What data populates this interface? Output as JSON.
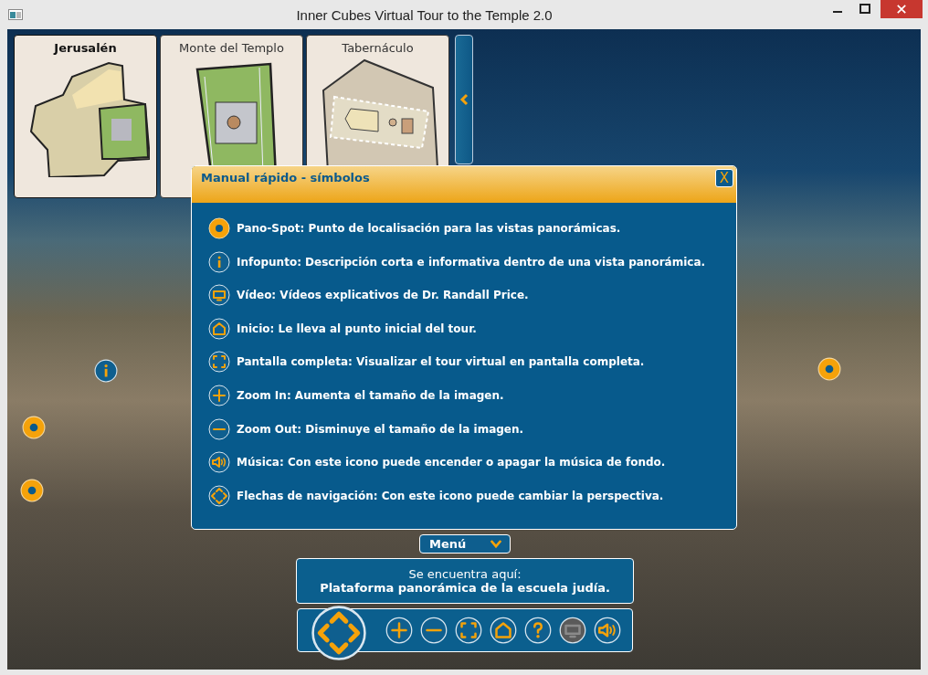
{
  "window": {
    "title": "Inner Cubes Virtual Tour to the Temple 2.0"
  },
  "maps": [
    {
      "label": "Jerusalén",
      "selected": true,
      "kind": "city"
    },
    {
      "label": "Monte del Templo",
      "selected": false,
      "kind": "mount"
    },
    {
      "label": "Tabernáculo",
      "selected": false,
      "kind": "tabernacle"
    }
  ],
  "hotspots": [
    {
      "kind": "info"
    },
    {
      "kind": "pano"
    },
    {
      "kind": "pano"
    },
    {
      "kind": "pano"
    }
  ],
  "dialog": {
    "title": "Manual rápido - símbolos",
    "close": "X",
    "items": [
      {
        "kind": "pano",
        "text": "Pano-Spot: Punto de localisación para las vistas panorámicas."
      },
      {
        "kind": "info",
        "text": "Infopunto: Descripción corta e informativa dentro de una vista panorámica."
      },
      {
        "kind": "video",
        "text": "Vídeo: Vídeos explicativos de Dr. Randall Price."
      },
      {
        "kind": "home",
        "text": "Inicio: Le lleva al punto inicial del tour."
      },
      {
        "kind": "fullscreen",
        "text": "Pantalla completa: Visualizar el tour virtual en pantalla completa."
      },
      {
        "kind": "plus",
        "text": "Zoom In: Aumenta el tamaño de la imagen."
      },
      {
        "kind": "minus",
        "text": "Zoom Out: Disminuye el tamaño de la imagen."
      },
      {
        "kind": "music",
        "text": "Música: Con este icono puede encender o apagar la música de fondo."
      },
      {
        "kind": "nav",
        "text": "Flechas de navigación: Con este icono puede cambiar la perspectiva."
      }
    ]
  },
  "menu": {
    "label": "Menú"
  },
  "location": {
    "caption": "Se encuentra aquí:",
    "place": "Plataforma panorámica de la escuela judía."
  },
  "toolbar": [
    {
      "kind": "plus",
      "disabled": false
    },
    {
      "kind": "minus",
      "disabled": false
    },
    {
      "kind": "fullscreen",
      "disabled": false
    },
    {
      "kind": "home",
      "disabled": false
    },
    {
      "kind": "help",
      "disabled": false
    },
    {
      "kind": "video",
      "disabled": true
    },
    {
      "kind": "music",
      "disabled": false
    }
  ]
}
